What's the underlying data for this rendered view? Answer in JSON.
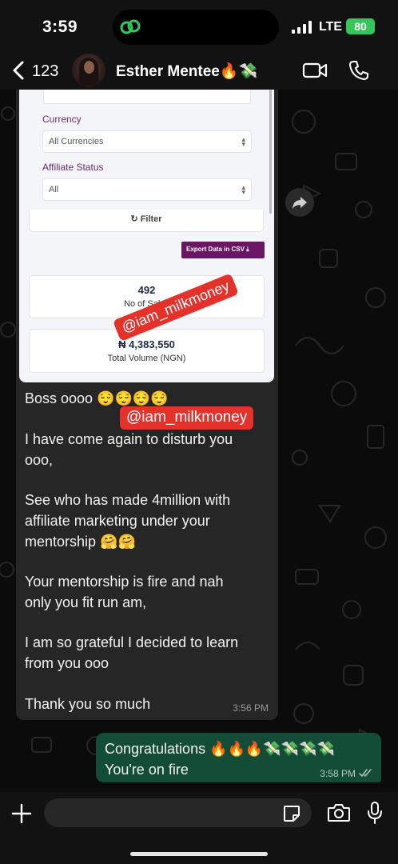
{
  "status_bar": {
    "time": "3:59",
    "network": "LTE",
    "battery": "80"
  },
  "header": {
    "back_count": "123",
    "contact_name": "Esther Mentee🔥💸"
  },
  "shared_screenshot": {
    "currency_label": "Currency",
    "currency_value": "All Currencies",
    "affiliate_status_label": "Affiliate Status",
    "affiliate_status_value": "All",
    "filter_label": "Filter",
    "export_label": "Export Data in CSV",
    "sales_count": "492",
    "sales_label": "No of Sales",
    "volume_value": "₦ 4,383,550",
    "volume_label": "Total Volume (NGN)"
  },
  "watermarks": [
    "@iam_milkmoney",
    "@iam_milkmoney"
  ],
  "messages": {
    "incoming": {
      "paragraphs": [
        "Boss oooo 😌😌😌😌",
        "I have come again to disturb you\nooo,",
        "See who has made 4million with\naffiliate marketing under your\nmentorship 🤗🤗",
        "Your mentorship is fire and nah\nonly you fit run am,",
        "I am so grateful I decided to learn\nfrom you ooo",
        "Thank you so much"
      ],
      "time": "3:56 PM"
    },
    "outgoing": {
      "text": "Congratulations 🔥🔥🔥💸💸💸💸\nYou're on fire",
      "time": "3:58 PM"
    }
  },
  "input": {
    "placeholder": ""
  },
  "icons": [
    "back-chevron-icon",
    "video-call-icon",
    "phone-icon",
    "forward-icon",
    "plus-icon",
    "sticker-icon",
    "camera-icon",
    "microphone-icon"
  ]
}
